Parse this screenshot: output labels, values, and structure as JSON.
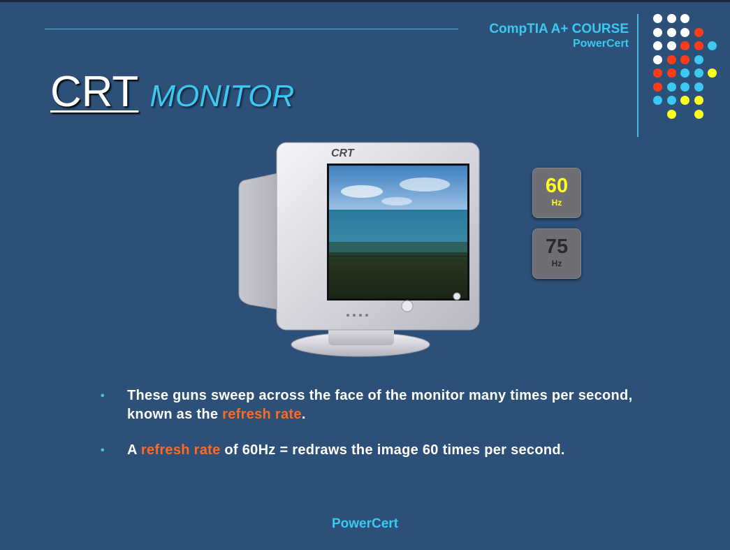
{
  "header": {
    "course": "CompTIA A+ COURSE",
    "brand": "PowerCert"
  },
  "title": {
    "main": "CRT",
    "sub": "MONITOR"
  },
  "monitor": {
    "brand_label": "CRT"
  },
  "refresh_buttons": [
    {
      "value": "60",
      "unit": "Hz",
      "active": true
    },
    {
      "value": "75",
      "unit": "Hz",
      "active": false
    }
  ],
  "bullets": [
    {
      "pre": "These guns sweep across the face of the monitor many times per second, known as the ",
      "highlight": "refresh rate",
      "post": "."
    },
    {
      "pre": "A ",
      "highlight": "refresh rate",
      "post": " of 60Hz = redraws the image 60 times per second."
    }
  ],
  "footer": {
    "brand": "PowerCert"
  },
  "colors": {
    "background": "#2c5078",
    "accent_cyan": "#3cc8f0",
    "highlight_orange": "#ff6a22",
    "active_hz": "#ffff20",
    "dot_white": "#ffffff",
    "dot_red": "#ff3b1a",
    "dot_cyan": "#3cc8f0",
    "dot_yellow": "#ffff20"
  },
  "dot_grid": [
    [
      "white",
      "white",
      "white",
      null,
      null
    ],
    [
      "white",
      "white",
      "white",
      "red",
      null
    ],
    [
      "white",
      "white",
      "red",
      "red",
      "cyan"
    ],
    [
      "white",
      "red",
      "red",
      "cyan",
      null
    ],
    [
      "red",
      "red",
      "cyan",
      "cyan",
      "yellow"
    ],
    [
      "red",
      "cyan",
      "cyan",
      "cyan",
      null
    ],
    [
      "cyan",
      "cyan",
      "yellow",
      "yellow",
      null
    ],
    [
      null,
      "yellow",
      null,
      "yellow",
      null
    ]
  ]
}
